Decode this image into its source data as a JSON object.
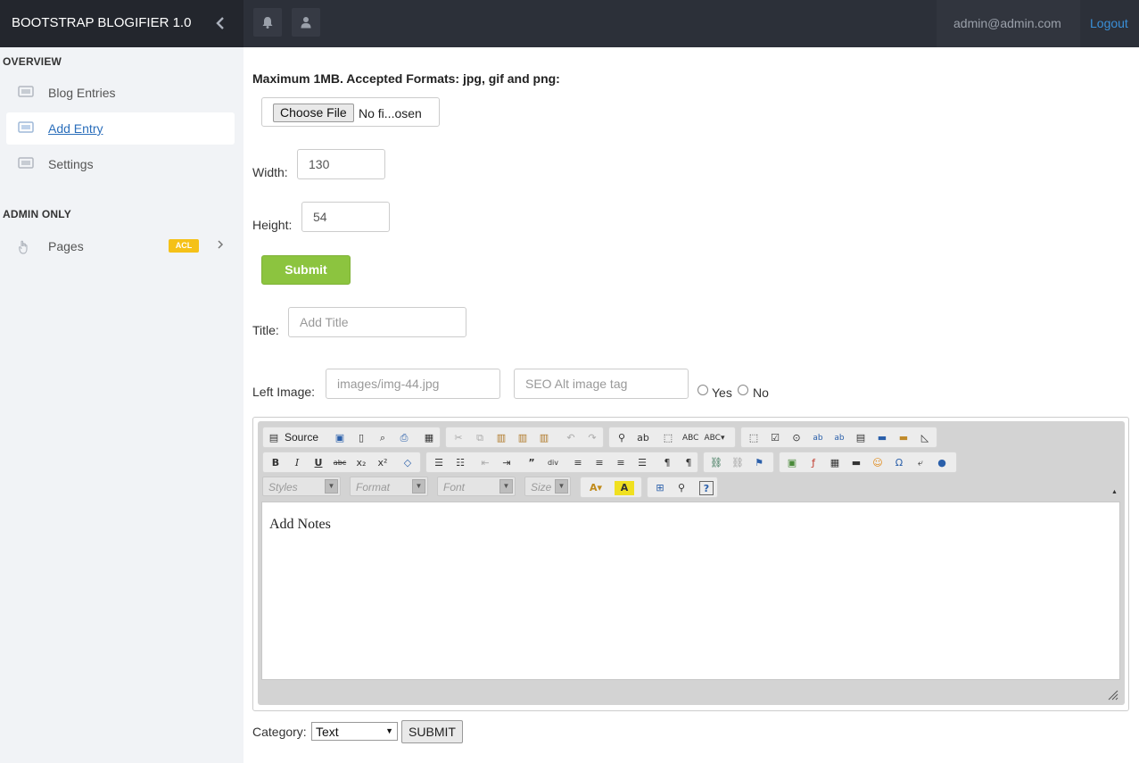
{
  "header": {
    "brand": "BOOTSTRAP BLOGIFIER 1.0",
    "user_email": "admin@admin.com",
    "logout": "Logout"
  },
  "sidebar": {
    "section_overview": "OVERVIEW",
    "section_admin": "ADMIN ONLY",
    "items": [
      {
        "label": "Blog Entries"
      },
      {
        "label": "Add Entry"
      },
      {
        "label": "Settings"
      }
    ],
    "pages": {
      "label": "Pages",
      "badge": "ACL"
    }
  },
  "upload": {
    "instructions": "Maximum 1MB. Accepted Formats: jpg, gif and png:",
    "choose_file": "Choose File",
    "file_status": "No fi...osen",
    "width_label": "Width:",
    "width_value": "130",
    "height_label": "Height:",
    "height_value": "54",
    "submit": "Submit"
  },
  "form": {
    "title_label": "Title:",
    "title_placeholder": "Add Title",
    "left_image_label": "Left Image:",
    "left_image_placeholder": "images/img-44.jpg",
    "seo_placeholder": "SEO Alt image tag",
    "yes": "Yes",
    "no": "No",
    "category_label": "Category:",
    "category_value": "Text",
    "submit": "SUBMIT"
  },
  "editor": {
    "source": "Source",
    "styles": "Styles",
    "format": "Format",
    "font": "Font",
    "size": "Size",
    "content": "Add Notes"
  }
}
